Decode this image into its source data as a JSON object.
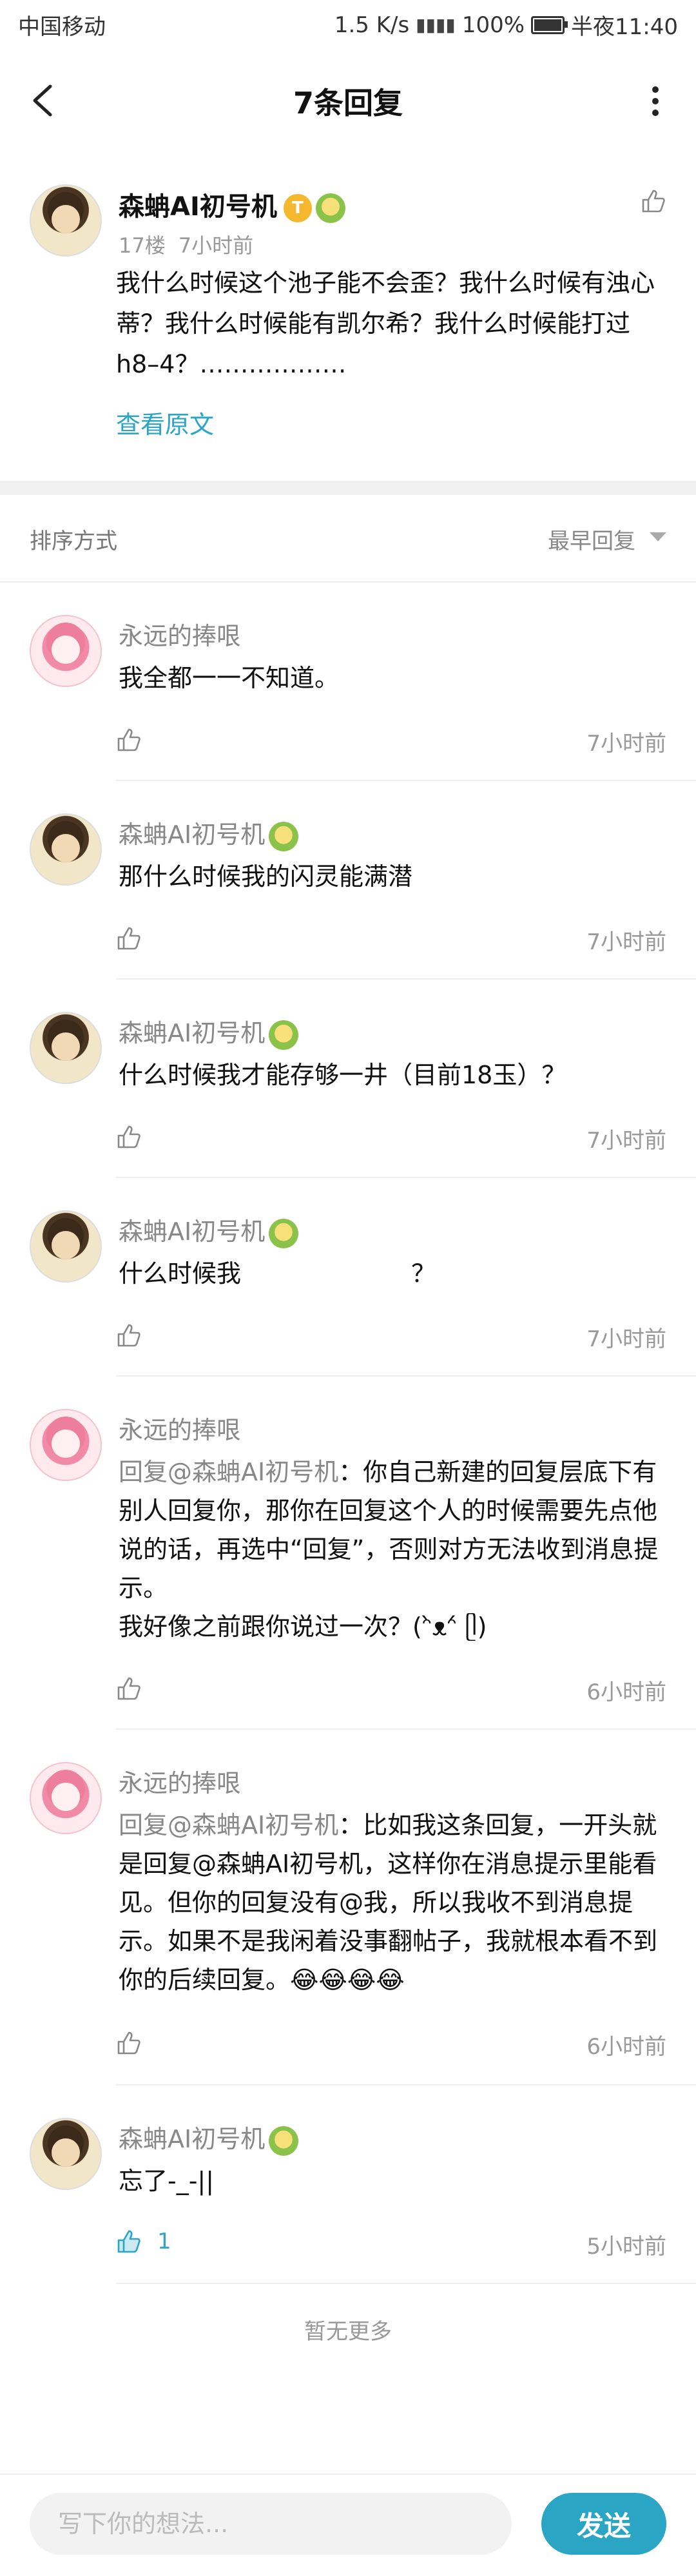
{
  "status_bar": {
    "carrier": "中国移动",
    "speed": "1.5 K/s",
    "battery": "100%",
    "battery_level": 1.0,
    "time": "半夜11:40"
  },
  "header": {
    "title": "7条回复"
  },
  "original_post": {
    "author": "森蚺AI初号机",
    "level_badge": "T",
    "floor": "17楼",
    "time": "7小时前",
    "content": "我什么时候这个池子能不会歪？我什么时候有浊心蒂？我什么时候能有凯尔希？我什么时候能打过h8–4？………………",
    "view_original": "查看原文"
  },
  "sort": {
    "label": "排序方式",
    "value": "最早回复"
  },
  "replies": [
    {
      "author": "永远的捧哏",
      "avatar": "girl",
      "mention": "",
      "content": "我全都一一不知道。",
      "likes": "",
      "time": "7小时前"
    },
    {
      "author": "森蚺AI初号机",
      "avatar": "boy",
      "mention": "",
      "content": "那什么时候我的闪灵能满潜",
      "likes": "",
      "time": "7小时前"
    },
    {
      "author": "森蚺AI初号机",
      "avatar": "boy",
      "mention": "",
      "content": "什么时候我才能存够一井（目前18玉）？",
      "likes": "",
      "time": "7小时前"
    },
    {
      "author": "森蚺AI初号机",
      "avatar": "boy",
      "mention": "",
      "content_before": "什么时候我",
      "content_after": "？",
      "likes": "",
      "time": "7小时前"
    },
    {
      "author": "永远的捧哏",
      "avatar": "girl",
      "mention": "回复@森蚺AI初号机",
      "content": "：你自己新建的回复层底下有别人回复你，那你在回复这个人的时候需要先点他说的话，再选中“回复”，否则对方无法收到消息提示。\n我好像之前跟你说过一次？(ᵔ̀ᴥᵔ́ ᥫ)",
      "likes": "",
      "time": "6小时前"
    },
    {
      "author": "永远的捧哏",
      "avatar": "girl",
      "mention": "回复@森蚺AI初号机",
      "content": "：比如我这条回复，一开头就是回复@森蚺AI初号机，这样你在消息提示里能看见。但你的回复没有@我，所以我收不到消息提示。如果不是我闲着没事翻帖子，我就根本看不到你的后续回复。😂😂😂😂",
      "likes": "",
      "time": "6小时前"
    },
    {
      "author": "森蚺AI初号机",
      "avatar": "boy",
      "mention": "",
      "content": "忘了-_-||",
      "likes": "1",
      "time": "5小时前"
    }
  ],
  "footer": {
    "no_more": "暂无更多"
  },
  "composer": {
    "placeholder": "写下你的想法...",
    "send_label": "发送"
  },
  "colors": {
    "accent": "#2aa6c4",
    "meta": "#999999",
    "divider": "#f0f0f0"
  }
}
